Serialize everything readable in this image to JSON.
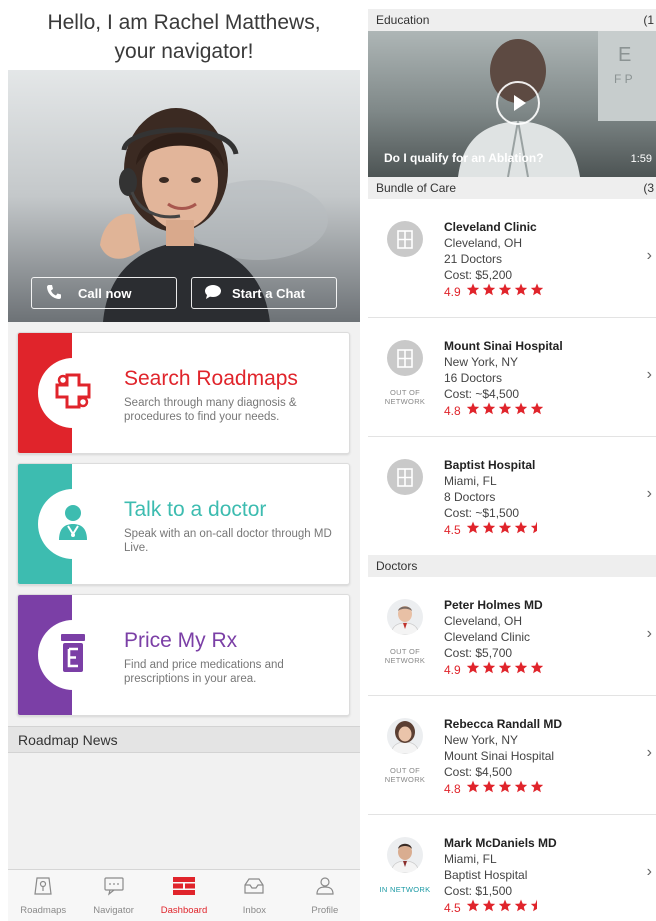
{
  "left": {
    "greeting_line1": "Hello, I am Rachel Matthews,",
    "greeting_line2": "your navigator!",
    "call_label": "Call now",
    "chat_label": "Start a Chat",
    "cards": [
      {
        "title": "Search Roadmaps",
        "desc": "Search through many diagnosis & procedures to find your needs.",
        "color": "#e0242b"
      },
      {
        "title": "Talk to a doctor",
        "desc": "Speak with an on-call doctor through MD Live.",
        "color": "#3dbcb0"
      },
      {
        "title": "Price My Rx",
        "desc": "Find and price medications and prescriptions in your area.",
        "color": "#7b3fa6"
      }
    ],
    "news_header": "Roadmap News",
    "tabs": [
      {
        "label": "Roadmaps",
        "icon": "roadmap-icon"
      },
      {
        "label": "Navigator",
        "icon": "chat-bubble-icon"
      },
      {
        "label": "Dashboard",
        "icon": "dashboard-icon"
      },
      {
        "label": "Inbox",
        "icon": "inbox-icon"
      },
      {
        "label": "Profile",
        "icon": "person-icon"
      }
    ]
  },
  "right": {
    "education": {
      "header": "Education",
      "count": "(1",
      "video_title": "Do I qualify for an Ablation?",
      "duration": "1:59"
    },
    "bundle": {
      "header": "Bundle of Care",
      "count": "(3",
      "items": [
        {
          "name": "Cleveland Clinic",
          "location": "Cleveland, OH",
          "doctors": "21 Doctors",
          "cost": "Cost: $5,200",
          "rating": "4.9",
          "stars": 5,
          "network": ""
        },
        {
          "name": "Mount Sinai Hospital",
          "location": "New York, NY",
          "doctors": "16 Doctors",
          "cost": "Cost: ~$4,500",
          "rating": "4.8",
          "stars": 5,
          "network": "OUT OF NETWORK"
        },
        {
          "name": "Baptist Hospital",
          "location": "Miami, FL",
          "doctors": "8 Doctors",
          "cost": "Cost: ~$1,500",
          "rating": "4.5",
          "stars": 4.5,
          "network": ""
        }
      ]
    },
    "doctors": {
      "header": "Doctors",
      "items": [
        {
          "name": "Peter Holmes MD",
          "location": "Cleveland, OH",
          "hospital": "Cleveland Clinic",
          "cost": "Cost: $5,700",
          "rating": "4.9",
          "stars": 5,
          "network": "OUT OF NETWORK"
        },
        {
          "name": "Rebecca Randall MD",
          "location": "New York, NY",
          "hospital": "Mount Sinai Hospital",
          "cost": "Cost: $4,500",
          "rating": "4.8",
          "stars": 5,
          "network": "OUT OF NETWORK"
        },
        {
          "name": "Mark McDaniels MD",
          "location": "Miami, FL",
          "hospital": "Baptist Hospital",
          "cost": "Cost: $1,500",
          "rating": "4.5",
          "stars": 4.5,
          "network": "IN NETWORK"
        }
      ]
    }
  },
  "colors": {
    "accent": "#e0242b",
    "in_network": "#1c9aa5"
  }
}
